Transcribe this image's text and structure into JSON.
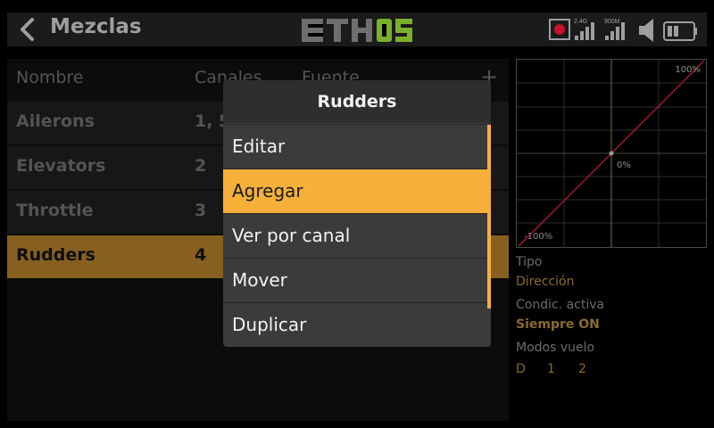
{
  "header": {
    "title": "Mezclas",
    "logo": "ETHOS",
    "rx_label": "2.4G",
    "ext_label": "900M"
  },
  "list": {
    "columns": [
      "Nombre",
      "Canales",
      "Fuente"
    ],
    "add_label": "+",
    "rows": [
      {
        "name": "Ailerons",
        "channels": "1, 5"
      },
      {
        "name": "Elevators",
        "channels": "2"
      },
      {
        "name": "Throttle",
        "channels": "3"
      },
      {
        "name": "Rudders",
        "channels": "4"
      }
    ]
  },
  "popup": {
    "title": "Rudders",
    "items": [
      "Editar",
      "Agregar",
      "Ver por canal",
      "Mover",
      "Duplicar"
    ],
    "selected": "Agregar"
  },
  "graph": {
    "top_label": "100%",
    "center_label": "0%",
    "bottom_label": "-100%"
  },
  "details": {
    "tipo_label": "Tipo",
    "tipo_value": "Dirección",
    "cond_label": "Condic. activa",
    "cond_value": "Siempre ON",
    "modes_label": "Modos vuelo",
    "modes": [
      "D",
      "1",
      "2"
    ]
  },
  "colors": {
    "accent": "#f6b039",
    "logo_green": "#7ab02a"
  }
}
